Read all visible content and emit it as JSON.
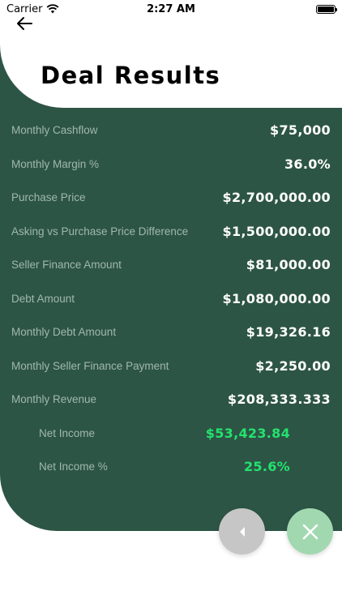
{
  "status_bar": {
    "carrier": "Carrier",
    "time": "2:27 AM"
  },
  "header": {
    "title": "Deal Results",
    "back_icon": "arrow-left-icon"
  },
  "results": [
    {
      "label": "Monthly Cashflow",
      "value": "$75,000"
    },
    {
      "label": "Monthly Margin %",
      "value": "36.0%"
    },
    {
      "label": "Purchase Price",
      "value": "$2,700,000.00"
    },
    {
      "label": "Asking vs Purchase Price Difference",
      "value": "$1,500,000.00"
    },
    {
      "label": "Seller Finance Amount",
      "value": "$81,000.00"
    },
    {
      "label": "Debt Amount",
      "value": "$1,080,000.00"
    },
    {
      "label": "Monthly Debt Amount",
      "value": "$19,326.16"
    },
    {
      "label": "Monthly Seller Finance Payment",
      "value": "$2,250.00"
    },
    {
      "label": "Monthly Revenue",
      "value": "$208,333.333"
    },
    {
      "label": "Net Income",
      "value": "$53,423.84"
    },
    {
      "label": "Net Income %",
      "value": "25.6%"
    }
  ],
  "actions": {
    "back_icon": "caret-left-icon",
    "close_icon": "close-icon"
  },
  "colors": {
    "panel": "#2d5545",
    "label": "#9fb8ad",
    "value": "#ffffff",
    "highlight": "#22e36e",
    "fab_back": "#c6c6c6",
    "fab_close": "#a2d8b0"
  }
}
